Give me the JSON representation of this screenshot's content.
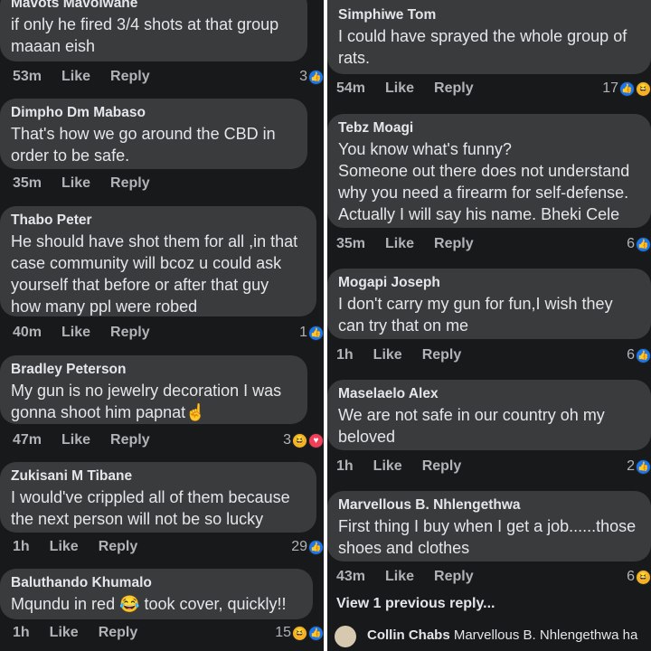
{
  "left_comments": [
    {
      "name": "Mavots Mavolwane",
      "text": [
        "if only he fired 3/4 shots at that group",
        "maaan eish"
      ],
      "time": "53m",
      "like": "Like",
      "reply": "Reply",
      "reaction_count": "3",
      "reactions": [
        "like"
      ]
    },
    {
      "name": "Dimpho Dm Mabaso",
      "text": [
        "That's how we go around the CBD in",
        "order to be safe."
      ],
      "time": "35m",
      "like": "Like",
      "reply": "Reply",
      "reaction_count": "",
      "reactions": []
    },
    {
      "name": "Thabo Peter",
      "text": [
        "He should have shot them for all ,in that",
        "case community will bcoz u could ask",
        "yourself that before or after that guy",
        "how many ppl were robed"
      ],
      "time": "40m",
      "like": "Like",
      "reply": "Reply",
      "reaction_count": "1",
      "reactions": [
        "like"
      ]
    },
    {
      "name": "Bradley Peterson",
      "text": [
        "My gun is no jewelry decoration I was",
        "gonna shoot him papnat☝"
      ],
      "time": "47m",
      "like": "Like",
      "reply": "Reply",
      "reaction_count": "3",
      "reactions": [
        "haha",
        "love"
      ]
    },
    {
      "name": "Zukisani M Tibane",
      "text": [
        "I would've crippled all of them because",
        "the next person will not be so lucky"
      ],
      "time": "1h",
      "like": "Like",
      "reply": "Reply",
      "reaction_count": "29",
      "reactions": [
        "like"
      ]
    },
    {
      "name": "Baluthando Khumalo",
      "text": [
        "Mqundu in red 😂 took cover, quickly!!"
      ],
      "time": "1h",
      "like": "Like",
      "reply": "Reply",
      "reaction_count": "15",
      "reactions": [
        "haha",
        "like"
      ]
    }
  ],
  "right_comments": [
    {
      "name": "Simphiwe Tom",
      "text": [
        "I could have sprayed the whole group of",
        "rats."
      ],
      "time": "54m",
      "like": "Like",
      "reply": "Reply",
      "reaction_count": "17",
      "reactions": [
        "like",
        "haha"
      ]
    },
    {
      "name": "Tebz Moagi",
      "text": [
        "You know what's funny?",
        "Someone out there does not understand",
        "why you need a firearm for self-defense.",
        "Actually I will say his name. Bheki Cele"
      ],
      "time": "35m",
      "like": "Like",
      "reply": "Reply",
      "reaction_count": "6",
      "reactions": [
        "like"
      ]
    },
    {
      "name": "Mogapi Joseph",
      "text": [
        "I don't carry my gun for fun,I wish they",
        "can try that on me"
      ],
      "time": "1h",
      "like": "Like",
      "reply": "Reply",
      "reaction_count": "6",
      "reactions": [
        "like"
      ]
    },
    {
      "name": "Maselaelo Alex",
      "text": [
        "We are not safe in our country oh my",
        "beloved"
      ],
      "time": "1h",
      "like": "Like",
      "reply": "Reply",
      "reaction_count": "2",
      "reactions": [
        "like"
      ]
    },
    {
      "name": "Marvellous B. Nhlengethwa",
      "text": [
        "First thing I buy when I get a job......those",
        "shoes and clothes"
      ],
      "time": "43m",
      "like": "Like",
      "reply": "Reply",
      "reaction_count": "6",
      "reactions": [
        "haha"
      ]
    }
  ],
  "view_previous": "View 1 previous reply...",
  "cut_reply": {
    "name": "Collin Chabs",
    "text": "Marvellous B. Nhlengethwa ha"
  },
  "colors": {
    "background": "#18191a",
    "bubble": "#3a3b3c",
    "like_blue": "#1877f2",
    "haha_yellow": "#f7b125",
    "love_red": "#f33e58"
  }
}
